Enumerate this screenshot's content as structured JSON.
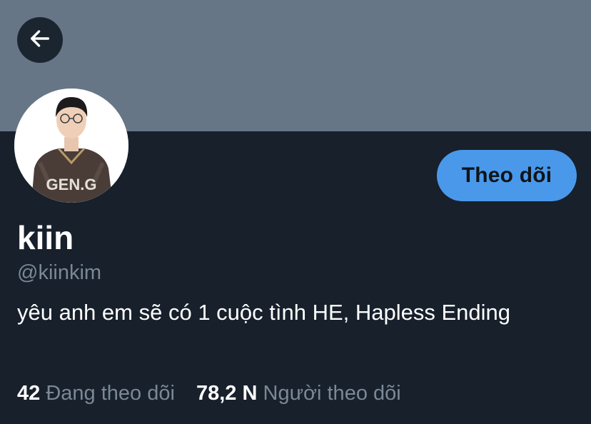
{
  "header": {
    "back_icon": "arrow-left-icon",
    "banner_color": "#667686"
  },
  "profile": {
    "avatar_icon": "profile-photo",
    "avatar_text": "GEN.G",
    "display_name": "kiin",
    "handle": "@kiinkim",
    "bio": "yêu anh em sẽ có 1 cuộc tình HE, Hapless Ending",
    "follow_label": "Theo dõi",
    "follow_color": "#4a98ea"
  },
  "stats": {
    "following_count": "42",
    "following_label": "Đang theo dõi",
    "followers_count": "78,2 N",
    "followers_label": "Người theo dõi"
  }
}
